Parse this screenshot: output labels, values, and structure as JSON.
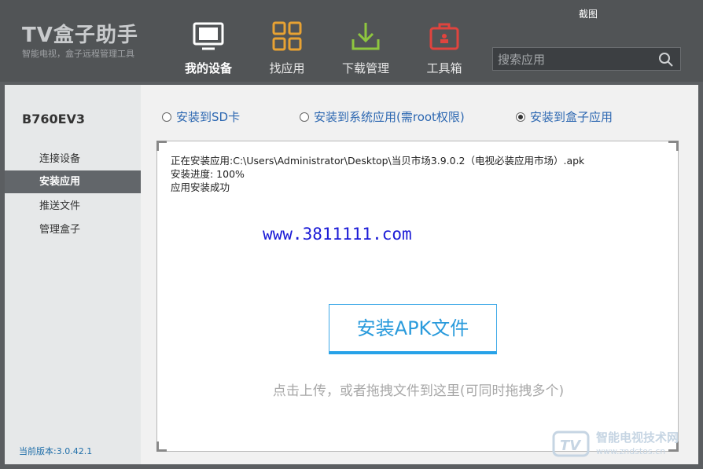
{
  "header": {
    "logo_title": "TV盒子助手",
    "logo_subtitle": "智能电视，盒子远程管理工具",
    "screenshot_label": "截图",
    "tabs": [
      {
        "label": "我的设备",
        "icon": "tv-icon",
        "active": true
      },
      {
        "label": "找应用",
        "icon": "grid-icon",
        "active": false
      },
      {
        "label": "下载管理",
        "icon": "download-icon",
        "active": false
      },
      {
        "label": "工具箱",
        "icon": "toolbox-icon",
        "active": false
      }
    ],
    "search": {
      "placeholder": "搜索应用",
      "value": ""
    }
  },
  "sidebar": {
    "device_name": "B760EV3",
    "items": [
      {
        "label": "连接设备",
        "active": false
      },
      {
        "label": "安装应用",
        "active": true
      },
      {
        "label": "推送文件",
        "active": false
      },
      {
        "label": "管理盒子",
        "active": false
      }
    ],
    "version": "当前版本:3.0.42.1"
  },
  "install_options": {
    "options": [
      {
        "label": "安装到SD卡",
        "checked": false
      },
      {
        "label": "安装到系统应用(需root权限)",
        "checked": false
      },
      {
        "label": "安装到盒子应用",
        "checked": true
      }
    ]
  },
  "log": {
    "line1": "正在安装应用:C:\\Users\\Administrator\\Desktop\\当贝市场3.9.0.2（电视必装应用市场）.apk",
    "line2": "安装进度:  100%",
    "line3": "应用安装成功"
  },
  "overlay_url": "www.3811111.com",
  "install_button_label": "安装APK文件",
  "drop_hint": "点击上传，或者拖拽文件到这里(可同时拖拽多个)",
  "site_watermark": {
    "title": "智能电视技术网",
    "url": "www.zndstos.cn"
  },
  "colors": {
    "header_bg": "#515456",
    "accent_blue": "#2a9bdc",
    "sidebar_active": "#62666a",
    "tab_grid": "#e8a233",
    "tab_download": "#8ec63f",
    "tab_toolbox": "#e0443e"
  }
}
